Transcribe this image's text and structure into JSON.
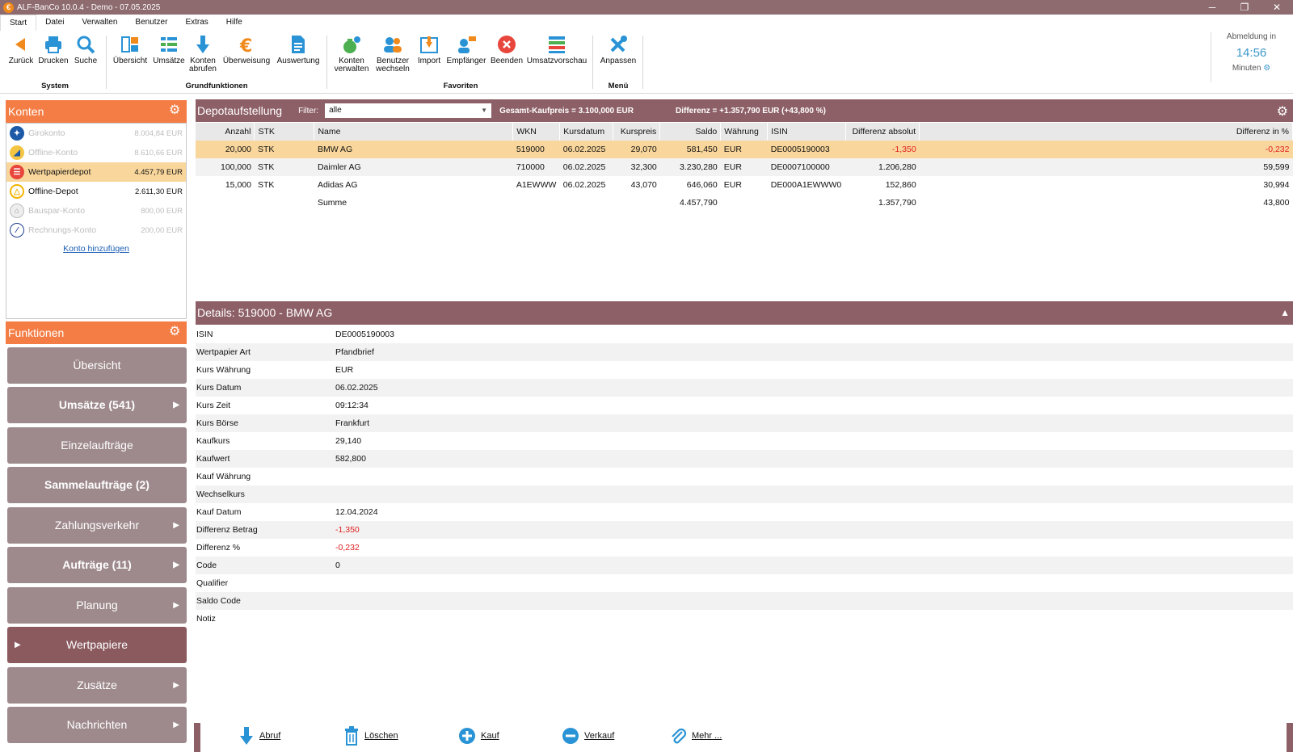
{
  "window": {
    "title": "ALF-BanCo 10.0.4 - Demo - 07.05.2025",
    "logo": "€",
    "controls": [
      "─",
      "❐",
      "✕"
    ]
  },
  "menu": [
    "Start",
    "Datei",
    "Verwalten",
    "Benutzer",
    "Extras",
    "Hilfe"
  ],
  "ribbon": {
    "buttons": {
      "zurueck": "Zurück",
      "drucken": "Drucken",
      "suche": "Suche",
      "uebersicht": "Übersicht",
      "umsaetze": "Umsätze",
      "konten_abrufen_1": "Konten",
      "konten_abrufen_2": "abrufen",
      "ueberweisung": "Überweisung",
      "auswertung": "Auswertung",
      "konten_verwalten_1": "Konten",
      "konten_verwalten_2": "verwalten",
      "benutzer_wechseln_1": "Benutzer",
      "benutzer_wechseln_2": "wechseln",
      "import": "Import",
      "empfaenger": "Empfänger",
      "beenden": "Beenden",
      "umsatzvorschau": "Umsatzvorschau",
      "anpassen": "Anpassen"
    },
    "groups": {
      "system": "System",
      "grundfunktionen": "Grundfunktionen",
      "favoriten": "Favoriten",
      "menue": "Menü"
    }
  },
  "logout": {
    "label": "Abmeldung in",
    "time": "14:56",
    "unit": "Minuten"
  },
  "konten": {
    "title": "Konten",
    "accounts": [
      {
        "name": "Girokonto",
        "balance": "8.004,84 EUR"
      },
      {
        "name": "Offline-Konto",
        "balance": "8.610,66 EUR"
      },
      {
        "name": "Wertpapierdepot",
        "balance": "4.457,79 EUR"
      },
      {
        "name": "Offline-Depot",
        "balance": "2.611,30 EUR"
      },
      {
        "name": "Bauspar-Konto",
        "balance": "800,00 EUR"
      },
      {
        "name": "Rechnungs-Konto",
        "balance": "200,00 EUR"
      }
    ],
    "add_link": "Konto hinzufügen"
  },
  "funktionen": {
    "title": "Funktionen",
    "items": [
      "Übersicht",
      "Umsätze (541)",
      "Einzelaufträge",
      "Sammelaufträge (2)",
      "Zahlungsverkehr",
      "Aufträge (11)",
      "Planung",
      "Wertpapiere",
      "Zusätze",
      "Nachrichten"
    ]
  },
  "depot": {
    "title": "Depotaufstellung",
    "filter_label": "Filter:",
    "filter_value": "alle",
    "gesamt": "Gesamt-Kaufpreis = 3.100,000 EUR",
    "differenz": "Differenz = +1.357,790 EUR (+43,800 %)",
    "columns": [
      "Anzahl",
      "STK",
      "Name",
      "WKN",
      "Kursdatum",
      "Kurspreis",
      "Saldo",
      "Währung",
      "ISIN",
      "Differenz absolut",
      "Differenz in %"
    ],
    "rows": [
      [
        "20,000",
        "STK",
        "BMW AG",
        "519000",
        "06.02.2025",
        "29,070",
        "581,450",
        "EUR",
        "DE0005190003",
        "-1,350",
        "-0,232"
      ],
      [
        "100,000",
        "STK",
        "Daimler AG",
        "710000",
        "06.02.2025",
        "32,300",
        "3.230,280",
        "EUR",
        "DE0007100000",
        "1.206,280",
        "59,599"
      ],
      [
        "15,000",
        "STK",
        "Adidas AG",
        "A1EWWW",
        "06.02.2025",
        "43,070",
        "646,060",
        "EUR",
        "DE000A1EWWW0",
        "152,860",
        "30,994"
      ]
    ],
    "sum": {
      "label": "Summe",
      "saldo": "4.457,790",
      "diff_abs": "1.357,790",
      "diff_pct": "43,800"
    }
  },
  "details": {
    "title": "Details: 519000 - BMW AG",
    "rows": [
      [
        "ISIN",
        "DE0005190003"
      ],
      [
        "Wertpapier Art",
        "Pfandbrief"
      ],
      [
        "Kurs Währung",
        "EUR"
      ],
      [
        "Kurs Datum",
        "06.02.2025"
      ],
      [
        "Kurs Zeit",
        "09:12:34"
      ],
      [
        "Kurs Börse",
        "Frankfurt"
      ],
      [
        "Kaufkurs",
        "29,140"
      ],
      [
        "Kaufwert",
        "582,800"
      ],
      [
        "Kauf Währung",
        ""
      ],
      [
        "Wechselkurs",
        ""
      ],
      [
        "Kauf Datum",
        "12.04.2024"
      ],
      [
        "Differenz Betrag",
        "-1,350"
      ],
      [
        "Differenz %",
        "-0,232"
      ],
      [
        "Code",
        "0"
      ],
      [
        "Qualifier",
        ""
      ],
      [
        "Saldo Code",
        ""
      ],
      [
        "Notiz",
        ""
      ]
    ]
  },
  "actions": {
    "abruf": "Abruf",
    "loeschen": "Löschen",
    "kauf": "Kauf",
    "verkauf": "Verkauf",
    "mehr": "Mehr ..."
  },
  "colors": {
    "accent": "#f37d45",
    "brand": "#8d6067",
    "selection": "#f9d79c",
    "negative": "#e02020",
    "icon_blue": "#2a93d5"
  }
}
